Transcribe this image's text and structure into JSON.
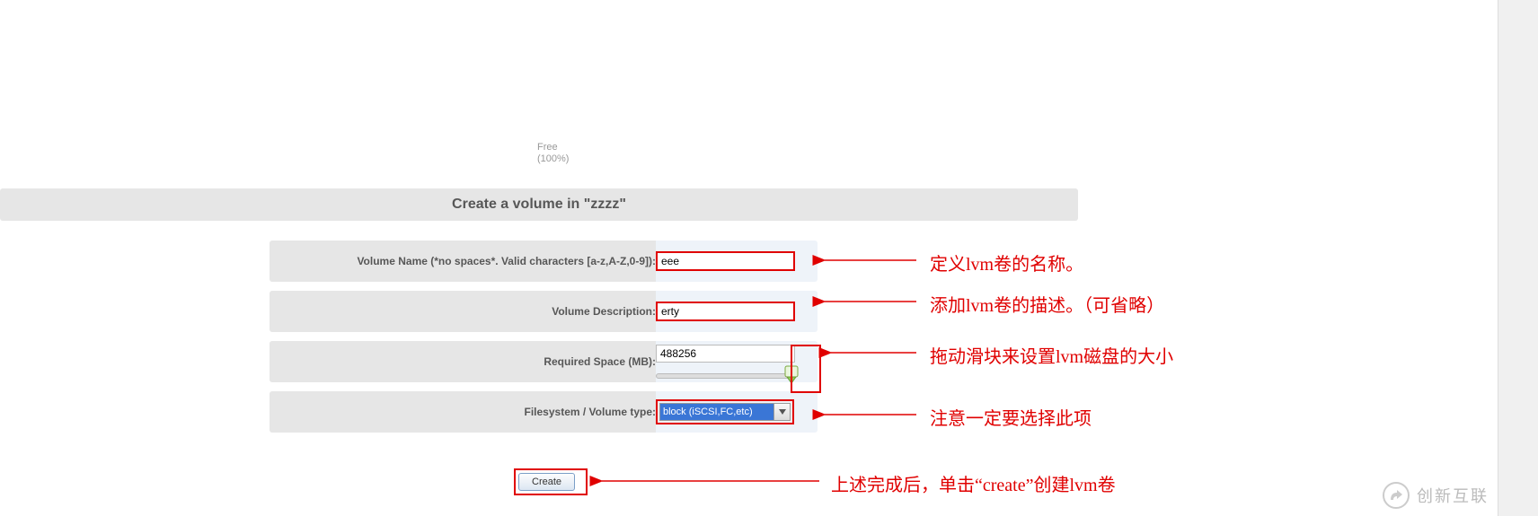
{
  "free_label": "Free\n(100%)",
  "title": "Create a volume in \"zzzz\"",
  "form": {
    "volume_name": {
      "label": "Volume Name (*no spaces*. Valid characters [a-z,A-Z,0-9]):",
      "value": "eee"
    },
    "volume_desc": {
      "label": "Volume Description:",
      "value": "erty"
    },
    "required_space": {
      "label": "Required Space (MB):",
      "value": "488256"
    },
    "fs_type": {
      "label": "Filesystem / Volume type:",
      "value": "block (iSCSI,FC,etc)"
    }
  },
  "buttons": {
    "create": "Create"
  },
  "annotations": {
    "name": "定义lvm卷的名称。",
    "desc": "添加lvm卷的描述。（可省略）",
    "size": "拖动滑块来设置lvm磁盘的大小",
    "type": "注意一定要选择此项",
    "create": "上述完成后，单击“create”创建lvm卷"
  },
  "watermark": "创新互联"
}
